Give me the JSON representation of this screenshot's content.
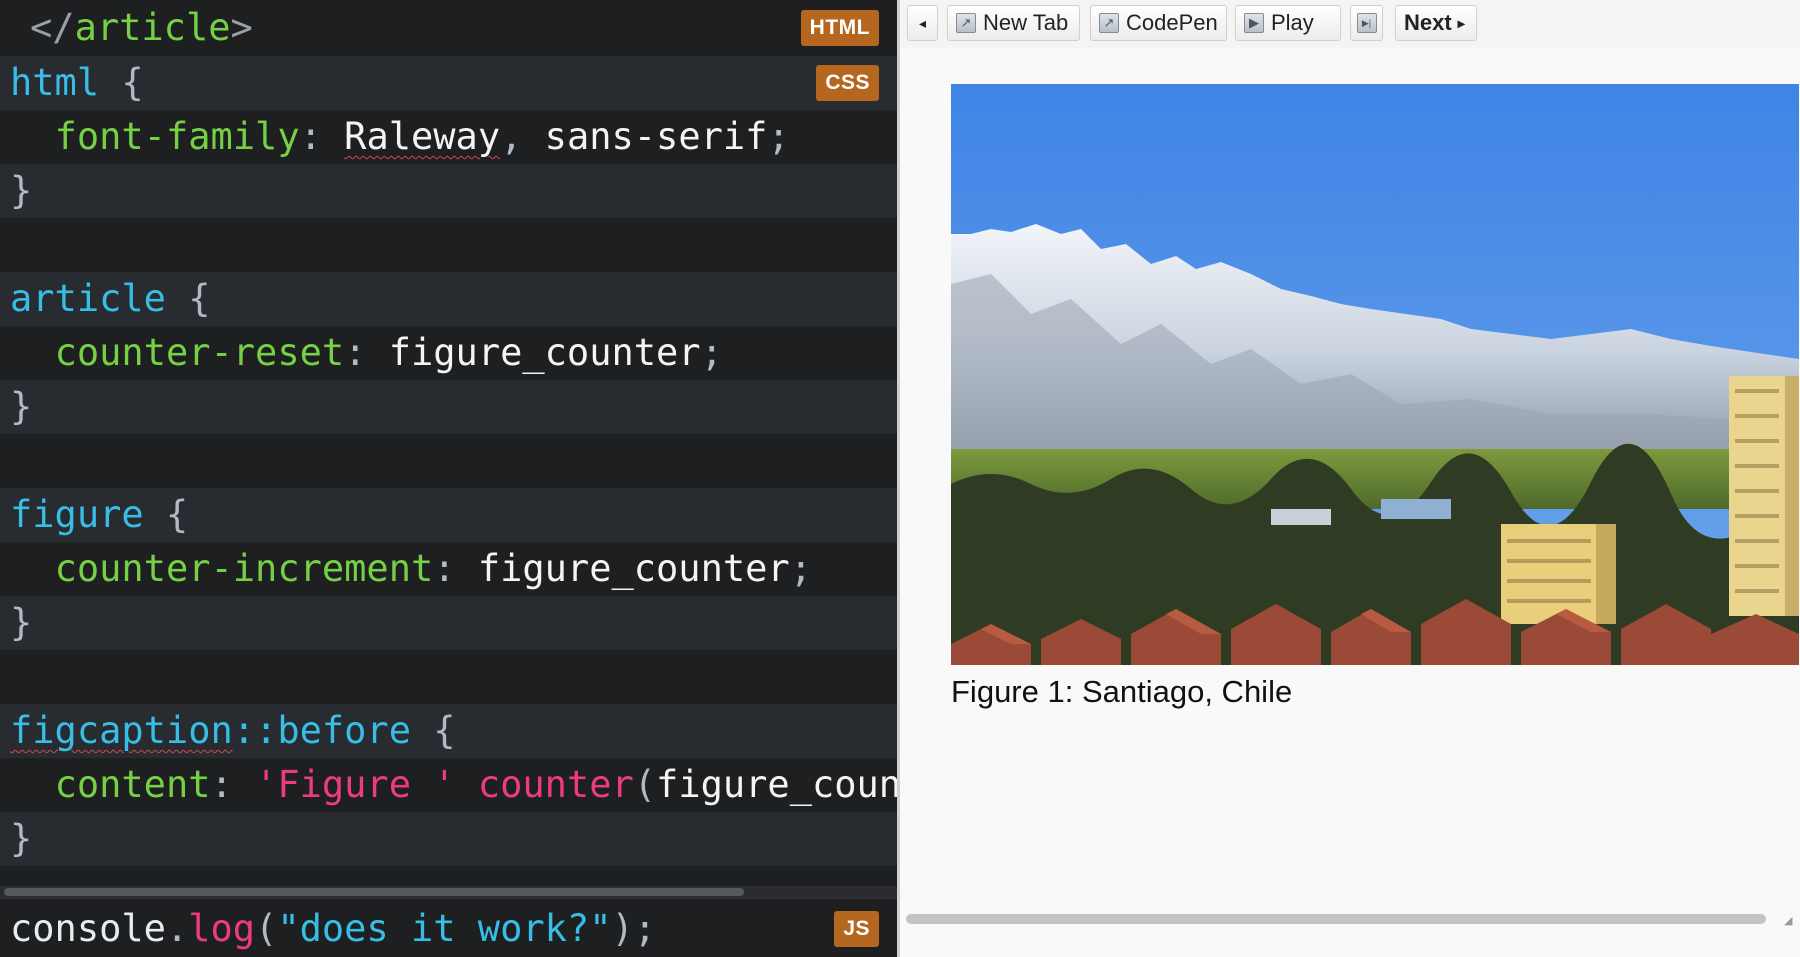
{
  "editor": {
    "html": {
      "badge": "HTML",
      "line": {
        "open": "</",
        "tag": "article",
        "close": ">"
      }
    },
    "css": {
      "badge": "CSS",
      "lines": [
        {
          "sel": "html",
          "open": " {"
        },
        {
          "prop": "font-family",
          "colon": ":",
          "val1": "Raleway",
          "punct1": ",",
          "val2": " sans-serif",
          "semi": ";"
        },
        {
          "brace": "}"
        },
        {},
        {
          "sel": "article",
          "open": " {"
        },
        {
          "prop": "counter-reset",
          "colon": ":",
          "val1": " figure_counter",
          "semi": ";"
        },
        {
          "brace": "}"
        },
        {},
        {
          "sel": "figure",
          "open": " {"
        },
        {
          "prop": "counter-increment",
          "colon": ":",
          "val1": " figure_counter",
          "semi": ";"
        },
        {
          "brace": "}"
        },
        {},
        {
          "sel": "figcaption",
          "pseudo": "::before",
          "open": " {"
        },
        {
          "prop": "content",
          "colon": ":",
          "str": " 'Figure '",
          "fn": " counter",
          "paren": "(",
          "arg": "figure_counte"
        },
        {
          "brace": "}"
        }
      ]
    },
    "js": {
      "badge": "JS",
      "obj": "console",
      "dot": ".",
      "fn": "log",
      "open": "(",
      "str": "\"does it work?\"",
      "close": ");"
    }
  },
  "preview": {
    "toolbar": {
      "back_glyph": "◂",
      "new_tab": "New Tab",
      "codepen": "CodePen",
      "play": "Play",
      "skip_glyph": "▶|",
      "next": "Next",
      "next_glyph": "▸"
    },
    "figure": {
      "alt": "Snow-covered Andes mountains above the city",
      "caption": "Figure 1: Santiago, Chile"
    },
    "colors": {
      "sky": "#4a8ee6",
      "snow": "#e6edf5",
      "badge": "#b5661f"
    }
  }
}
